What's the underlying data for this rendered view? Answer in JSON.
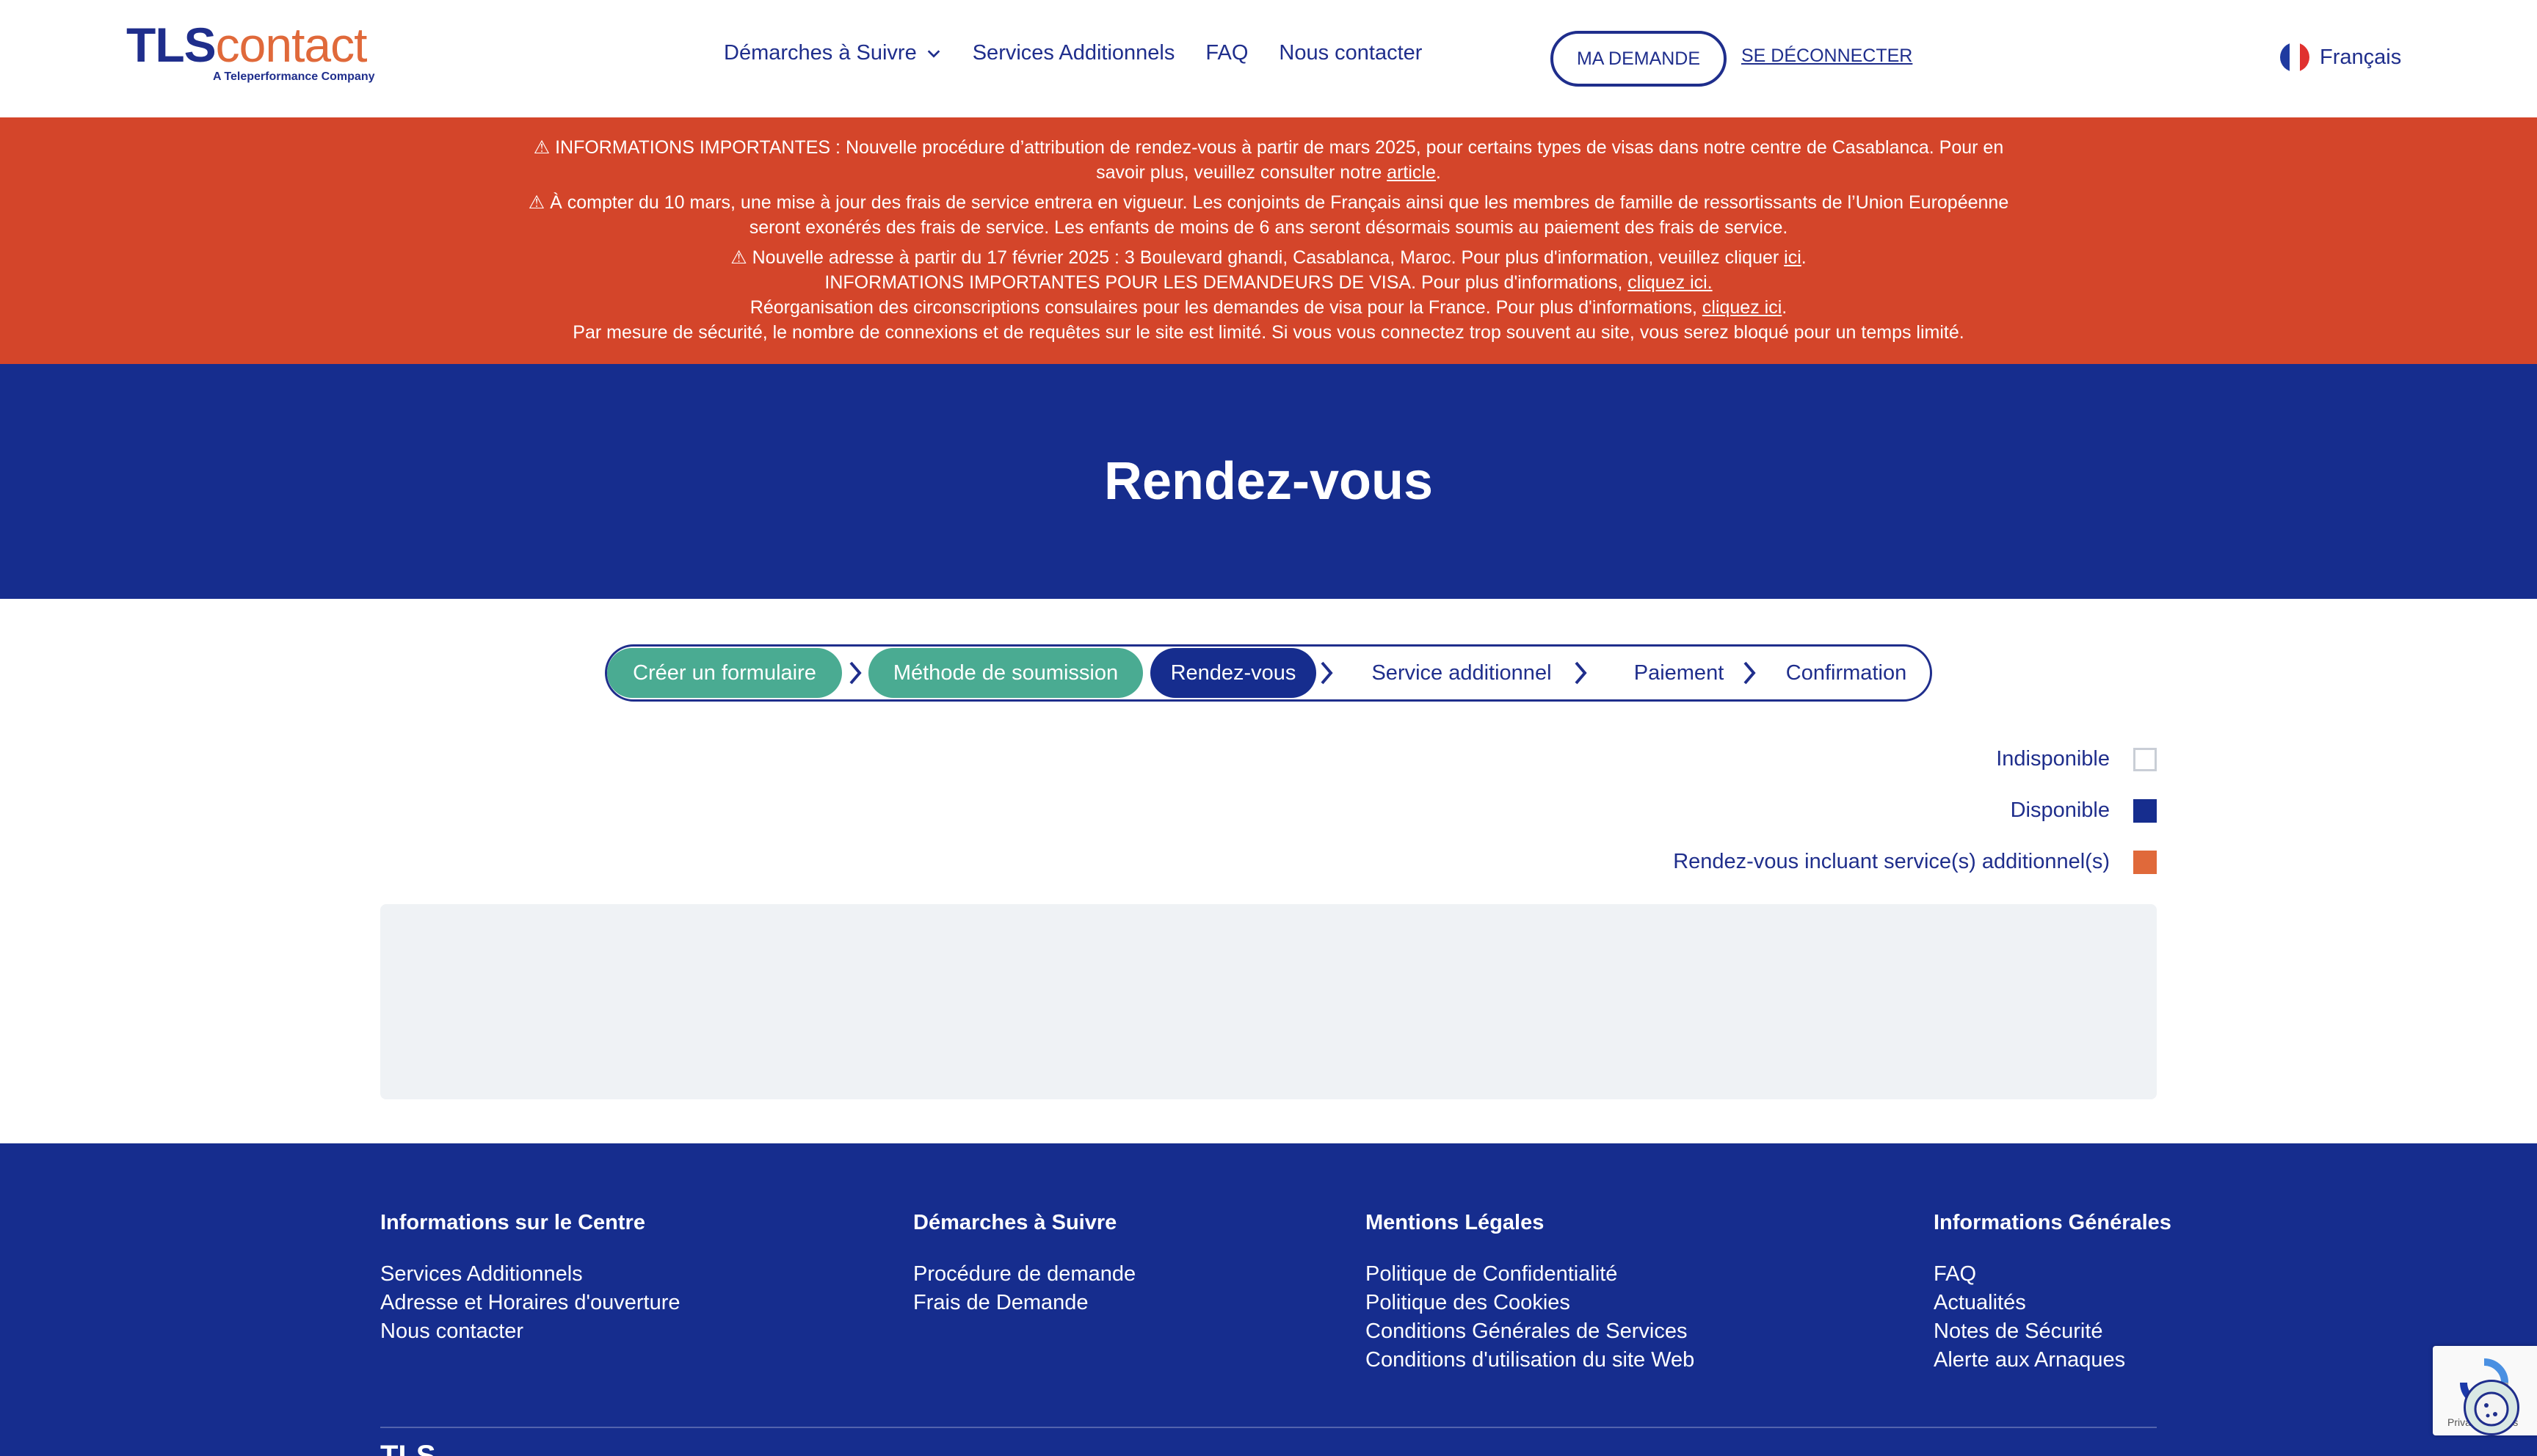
{
  "header": {
    "logo": {
      "brand_bold": "TLS",
      "brand_light": "contact",
      "tagline": "A Teleperformance Company"
    },
    "nav": [
      {
        "label": "Démarches à Suivre",
        "has_dropdown": true
      },
      {
        "label": "Services Additionnels"
      },
      {
        "label": "FAQ"
      },
      {
        "label": "Nous contacter"
      }
    ],
    "my_request_label": "MA DEMANDE",
    "logout_label": "SE DÉCONNECTER",
    "language": "Français"
  },
  "alerts": {
    "line1_pre": "⚠ INFORMATIONS IMPORTANTES : Nouvelle procédure d’attribution de rendez-vous à partir de mars 2025, pour certains types de visas dans notre centre de Casablanca. Pour en",
    "line1b_pre": "savoir plus, veuillez consulter notre ",
    "line1b_link": "article",
    "line1b_post": ".",
    "line2": "⚠ À compter du 10 mars, une mise à jour des frais de service entrera en vigueur. Les conjoints de Français ainsi que les membres de famille de ressortissants de l’Union Européenne",
    "line2b": "seront exonérés des frais de service. Les enfants de moins de 6 ans seront désormais soumis au paiement des frais de service.",
    "line3_pre": "⚠ Nouvelle adresse à partir du 17 février 2025 : 3 Boulevard ghandi, Casablanca, Maroc. Pour plus d'information, veuillez cliquer ",
    "line3_link": "ici",
    "line3_post": ".",
    "line4_pre": "INFORMATIONS IMPORTANTES POUR LES DEMANDEURS DE VISA. Pour plus d'informations, ",
    "line4_link": "cliquez ici.",
    "line5_pre": "Réorganisation des circonscriptions consulaires pour les demandes de visa pour la France. Pour plus d'informations, ",
    "line5_link": "cliquez ici",
    "line5_post": ".",
    "line6": "Par mesure de sécurité, le nombre de connexions et de requêtes sur le site est limité. Si vous vous connectez trop souvent au site, vous serez bloqué pour un temps limité."
  },
  "page_title": "Rendez-vous",
  "stepper": {
    "steps": [
      {
        "label": "Créer un formulaire",
        "state": "done"
      },
      {
        "label": "Méthode de soumission",
        "state": "done"
      },
      {
        "label": "Rendez-vous",
        "state": "active"
      },
      {
        "label": "Service additionnel",
        "state": "todo"
      },
      {
        "label": "Paiement",
        "state": "todo"
      },
      {
        "label": "Confirmation",
        "state": "todo"
      }
    ]
  },
  "legend": [
    {
      "label": "Indisponible",
      "color": "#ffffff"
    },
    {
      "label": "Disponible",
      "color": "#162d8e"
    },
    {
      "label": "Rendez-vous incluant service(s) additionnel(s)",
      "color": "#e0693a"
    }
  ],
  "footer": {
    "columns": [
      {
        "title": "Informations sur le Centre",
        "links": [
          "Services Additionnels",
          "Adresse et Horaires d'ouverture",
          "Nous contacter"
        ]
      },
      {
        "title": "Démarches à Suivre",
        "links": [
          "Procédure de demande",
          "Frais de Demande"
        ]
      },
      {
        "title": "Mentions Légales",
        "links": [
          "Politique de Confidentialité",
          "Politique des Cookies",
          "Conditions Générales de Services",
          "Conditions d'utilisation du site Web"
        ]
      },
      {
        "title": "Informations Générales",
        "links": [
          "FAQ",
          "Actualités",
          "Notes de Sécurité",
          "Alerte aux Arnaques"
        ]
      }
    ],
    "logo_text": "TLS"
  },
  "recaptcha": {
    "text": "Privacy - Terms"
  },
  "colors": {
    "primary": "#162d8e",
    "accent": "#e0693a",
    "alert": "#d4452a",
    "step_done": "#4aab92"
  }
}
